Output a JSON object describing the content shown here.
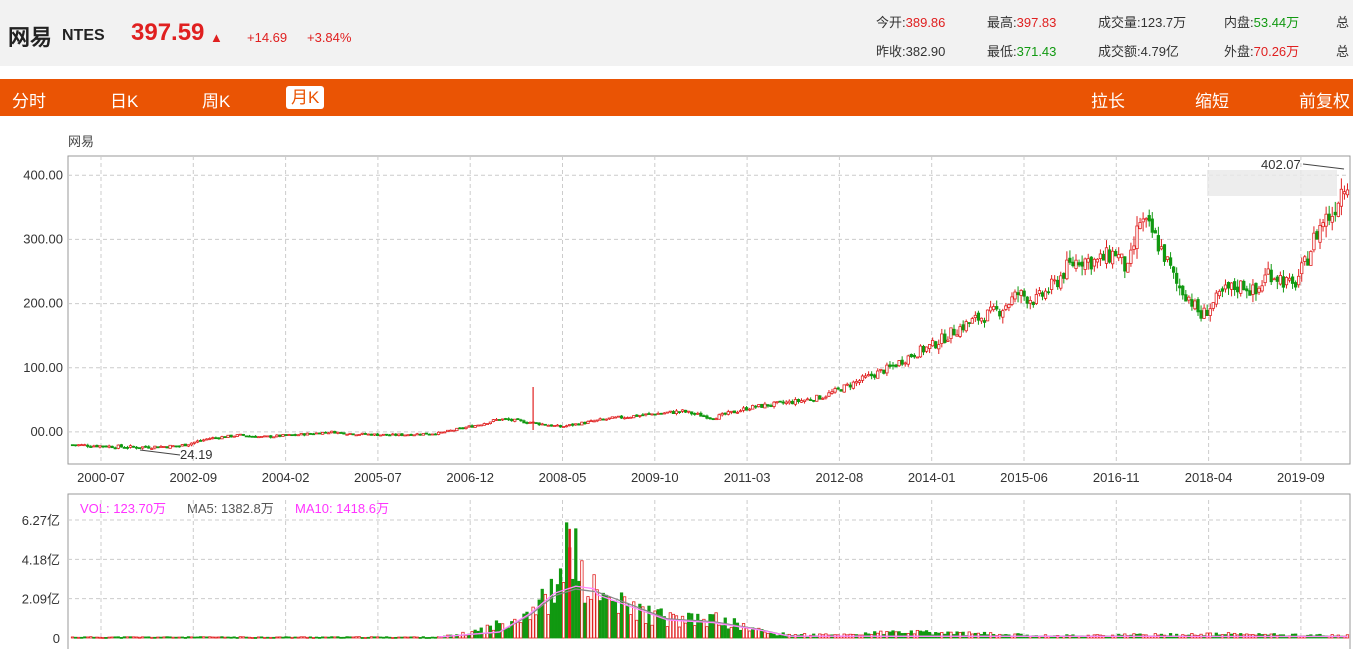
{
  "stock": {
    "name": "网易",
    "code": "NTES",
    "price": "397.59",
    "arrow": "▲",
    "change": "+14.69",
    "change_pct": "+3.84%"
  },
  "quote": {
    "open_label": "今开:",
    "open": "389.86",
    "high_label": "最高:",
    "high": "397.83",
    "volume_label": "成交量:",
    "volume": "123.7万",
    "inner_label": "内盘:",
    "inner": "53.44万",
    "more_label_1": "总",
    "prev_close_label": "昨收:",
    "prev_close": "382.90",
    "low_label": "最低:",
    "low": "371.43",
    "amount_label": "成交额:",
    "amount": "4.79亿",
    "outer_label": "外盘:",
    "outer": "70.26万",
    "more_label_2": "总"
  },
  "tabs": {
    "intraday": "分时",
    "daily": "日K",
    "weekly": "周K",
    "monthly": "月K",
    "stretch": "拉长",
    "shorten": "缩短",
    "adjust": "前复权"
  },
  "colors": {
    "up": "#e02020",
    "down": "#119911",
    "toolbar": "#ea5404",
    "ma5": "#666666",
    "ma10": "#ff33ff"
  },
  "chart_data": [
    {
      "type": "candlestick",
      "title": "网易",
      "y_ticks": [
        "400.00",
        "300.00",
        "200.00",
        "100.00",
        "00.00"
      ],
      "ylim": [
        -50,
        430
      ],
      "x_ticks": [
        "2000-07",
        "2002-09",
        "2004-02",
        "2005-07",
        "2006-12",
        "2008-05",
        "2009-10",
        "2011-03",
        "2012-08",
        "2014-01",
        "2015-06",
        "2016-11",
        "2018-04",
        "2019-09"
      ],
      "annotations": {
        "max_label": "402.07",
        "min_label": "24.19"
      },
      "grid": true,
      "close_keypoints": [
        [
          0,
          -20
        ],
        [
          20,
          -24
        ],
        [
          35,
          -22
        ],
        [
          45,
          -10
        ],
        [
          55,
          -5
        ],
        [
          62,
          -8
        ],
        [
          72,
          -5
        ],
        [
          85,
          0
        ],
        [
          92,
          -3
        ],
        [
          105,
          -5
        ],
        [
          120,
          -2
        ],
        [
          132,
          10
        ],
        [
          140,
          20
        ],
        [
          150,
          15
        ],
        [
          160,
          8
        ],
        [
          175,
          20
        ],
        [
          190,
          28
        ],
        [
          200,
          32
        ],
        [
          210,
          22
        ],
        [
          222,
          38
        ],
        [
          238,
          48
        ],
        [
          246,
          55
        ],
        [
          258,
          80
        ],
        [
          268,
          100
        ],
        [
          275,
          120
        ],
        [
          282,
          135
        ],
        [
          290,
          160
        ],
        [
          296,
          175
        ],
        [
          304,
          190
        ],
        [
          310,
          215
        ],
        [
          316,
          205
        ],
        [
          322,
          230
        ],
        [
          326,
          255
        ],
        [
          330,
          270
        ],
        [
          336,
          265
        ],
        [
          342,
          280
        ],
        [
          346,
          250
        ],
        [
          350,
          330
        ],
        [
          354,
          310
        ],
        [
          358,
          275
        ],
        [
          362,
          230
        ],
        [
          366,
          210
        ],
        [
          370,
          180
        ],
        [
          374,
          200
        ],
        [
          378,
          220
        ],
        [
          384,
          230
        ],
        [
          388,
          215
        ],
        [
          392,
          250
        ],
        [
          396,
          240
        ],
        [
          400,
          225
        ],
        [
          404,
          260
        ],
        [
          407,
          300
        ],
        [
          410,
          330
        ],
        [
          413,
          340
        ],
        [
          416,
          380
        ],
        [
          418,
          397
        ]
      ],
      "n": 419
    },
    {
      "type": "bar",
      "title": "",
      "y_ticks": [
        "6.27亿",
        "4.18亿",
        "2.09亿",
        "0"
      ],
      "ylim": [
        0,
        6.27
      ],
      "legend": [
        "VOL: 123.70万",
        "MA5: 1382.8万",
        "MA10: 1418.6万"
      ],
      "volume_keypoints": [
        [
          0,
          0.05
        ],
        [
          120,
          0.05
        ],
        [
          130,
          0.25
        ],
        [
          140,
          0.7
        ],
        [
          148,
          1.3
        ],
        [
          155,
          2.0
        ],
        [
          160,
          2.6
        ],
        [
          163,
          5.8
        ],
        [
          167,
          2.9
        ],
        [
          172,
          2.3
        ],
        [
          180,
          1.7
        ],
        [
          190,
          1.2
        ],
        [
          200,
          0.9
        ],
        [
          210,
          1.0
        ],
        [
          220,
          0.6
        ],
        [
          230,
          0.2
        ],
        [
          250,
          0.15
        ],
        [
          270,
          0.3
        ],
        [
          290,
          0.25
        ],
        [
          320,
          0.12
        ],
        [
          380,
          0.2
        ],
        [
          418,
          0.12
        ]
      ],
      "ma_keypoints": [
        [
          120,
          0.05
        ],
        [
          140,
          0.3
        ],
        [
          150,
          1.2
        ],
        [
          158,
          2.2
        ],
        [
          165,
          2.55
        ],
        [
          172,
          2.4
        ],
        [
          182,
          1.8
        ],
        [
          195,
          1.0
        ],
        [
          210,
          0.85
        ],
        [
          225,
          0.45
        ],
        [
          235,
          0.1
        ],
        [
          418,
          0.08
        ]
      ]
    }
  ]
}
